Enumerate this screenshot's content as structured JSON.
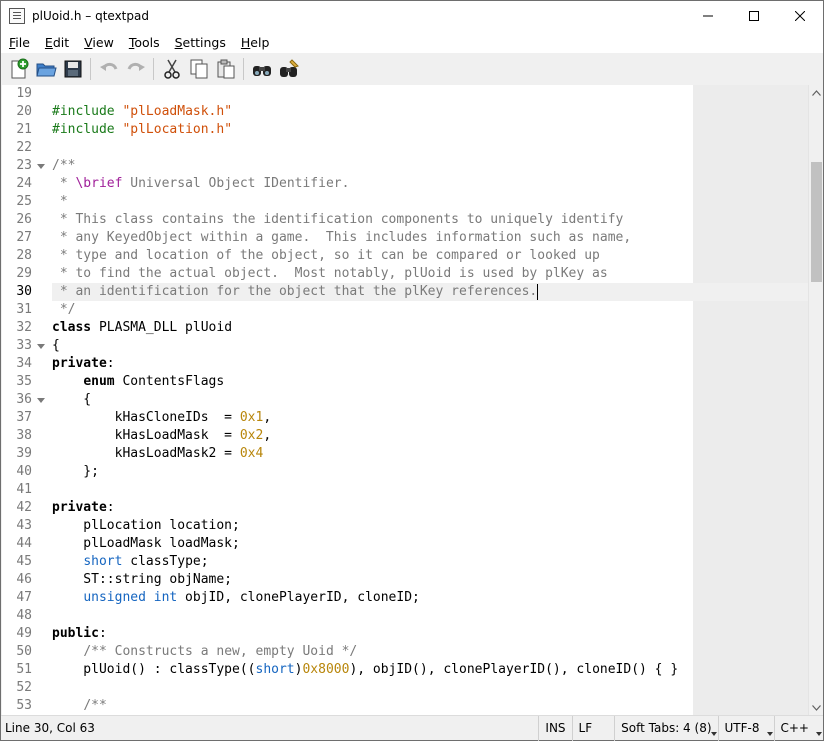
{
  "window": {
    "title": "plUoid.h – qtextpad"
  },
  "menu": [
    {
      "label": "File",
      "mnemonic": "F",
      "rest": "ile"
    },
    {
      "label": "Edit",
      "mnemonic": "E",
      "rest": "dit"
    },
    {
      "label": "View",
      "mnemonic": "V",
      "rest": "iew"
    },
    {
      "label": "Tools",
      "mnemonic": "T",
      "rest": "ools"
    },
    {
      "label": "Settings",
      "mnemonic": "S",
      "rest": "ettings"
    },
    {
      "label": "Help",
      "mnemonic": "H",
      "rest": "elp"
    }
  ],
  "toolbar": {
    "buttons": [
      "new-file-icon",
      "open-file-icon",
      "save-file-icon",
      "undo-icon",
      "redo-icon",
      "cut-icon",
      "copy-icon",
      "paste-icon",
      "find-icon",
      "find-replace-icon"
    ]
  },
  "editor": {
    "first_line": 19,
    "current_line": 30,
    "fold_lines": [
      23,
      33,
      36
    ],
    "lines": [
      [],
      [
        [
          "pp",
          "#include "
        ],
        [
          "str",
          "\"plLoadMask.h\""
        ]
      ],
      [
        [
          "pp",
          "#include "
        ],
        [
          "str",
          "\"plLocation.h\""
        ]
      ],
      [],
      [
        [
          "cmt",
          "/**"
        ]
      ],
      [
        [
          "cmt",
          " * "
        ],
        [
          "doc",
          "\\brief"
        ],
        [
          "cmt",
          " Universal Object IDentifier."
        ]
      ],
      [
        [
          "cmt",
          " *"
        ]
      ],
      [
        [
          "cmt",
          " * This class contains the identification components to uniquely identify"
        ]
      ],
      [
        [
          "cmt",
          " * any KeyedObject within a game.  This includes information such as name,"
        ]
      ],
      [
        [
          "cmt",
          " * type and location of the object, so it can be compared or looked up"
        ]
      ],
      [
        [
          "cmt",
          " * to find the actual object.  Most notably, plUoid is used by plKey as"
        ]
      ],
      [
        [
          "cmt",
          " * an identification for the object that the plKey references."
        ]
      ],
      [
        [
          "cmt",
          " */"
        ]
      ],
      [
        [
          "kw",
          "class"
        ],
        [
          "plain",
          " PLASMA_DLL plUoid"
        ]
      ],
      [
        [
          "plain",
          "{"
        ]
      ],
      [
        [
          "kw",
          "private"
        ],
        [
          "plain",
          ":"
        ]
      ],
      [
        [
          "plain",
          "    "
        ],
        [
          "kw",
          "enum"
        ],
        [
          "plain",
          " ContentsFlags"
        ]
      ],
      [
        [
          "plain",
          "    {"
        ]
      ],
      [
        [
          "plain",
          "        kHasCloneIDs  = "
        ],
        [
          "num",
          "0x1"
        ],
        [
          "plain",
          ","
        ]
      ],
      [
        [
          "plain",
          "        kHasLoadMask  = "
        ],
        [
          "num",
          "0x2"
        ],
        [
          "plain",
          ","
        ]
      ],
      [
        [
          "plain",
          "        kHasLoadMask2 = "
        ],
        [
          "num",
          "0x4"
        ]
      ],
      [
        [
          "plain",
          "    };"
        ]
      ],
      [],
      [
        [
          "kw",
          "private"
        ],
        [
          "plain",
          ":"
        ]
      ],
      [
        [
          "plain",
          "    plLocation location;"
        ]
      ],
      [
        [
          "plain",
          "    plLoadMask loadMask;"
        ]
      ],
      [
        [
          "plain",
          "    "
        ],
        [
          "type",
          "short"
        ],
        [
          "plain",
          " classType;"
        ]
      ],
      [
        [
          "plain",
          "    ST::string objName;"
        ]
      ],
      [
        [
          "plain",
          "    "
        ],
        [
          "type",
          "unsigned int"
        ],
        [
          "plain",
          " objID, clonePlayerID, cloneID;"
        ]
      ],
      [],
      [
        [
          "kw",
          "public"
        ],
        [
          "plain",
          ":"
        ]
      ],
      [
        [
          "plain",
          "    "
        ],
        [
          "cmt",
          "/** Constructs a new, empty Uoid */"
        ]
      ],
      [
        [
          "plain",
          "    plUoid() : classType(("
        ],
        [
          "type",
          "short"
        ],
        [
          "plain",
          ")"
        ],
        [
          "num",
          "0x8000"
        ],
        [
          "plain",
          "), objID(), clonePlayerID(), cloneID() { }"
        ]
      ],
      [],
      [
        [
          "plain",
          "    "
        ],
        [
          "cmt",
          "/**"
        ]
      ]
    ]
  },
  "status": {
    "position": "Line 30, Col 63",
    "insert_mode": "INS",
    "line_ending": "LF",
    "tabs": "Soft Tabs: 4 (8)",
    "encoding": "UTF-8",
    "language": "C++"
  },
  "colors": {
    "preprocessor": "#1a7a1a",
    "string": "#d0500a",
    "comment": "#7a7a7a",
    "doc_tag": "#a0209a",
    "type": "#1565c0",
    "number": "#b8860b"
  },
  "scrollbar": {
    "position_fraction": 0.13
  }
}
